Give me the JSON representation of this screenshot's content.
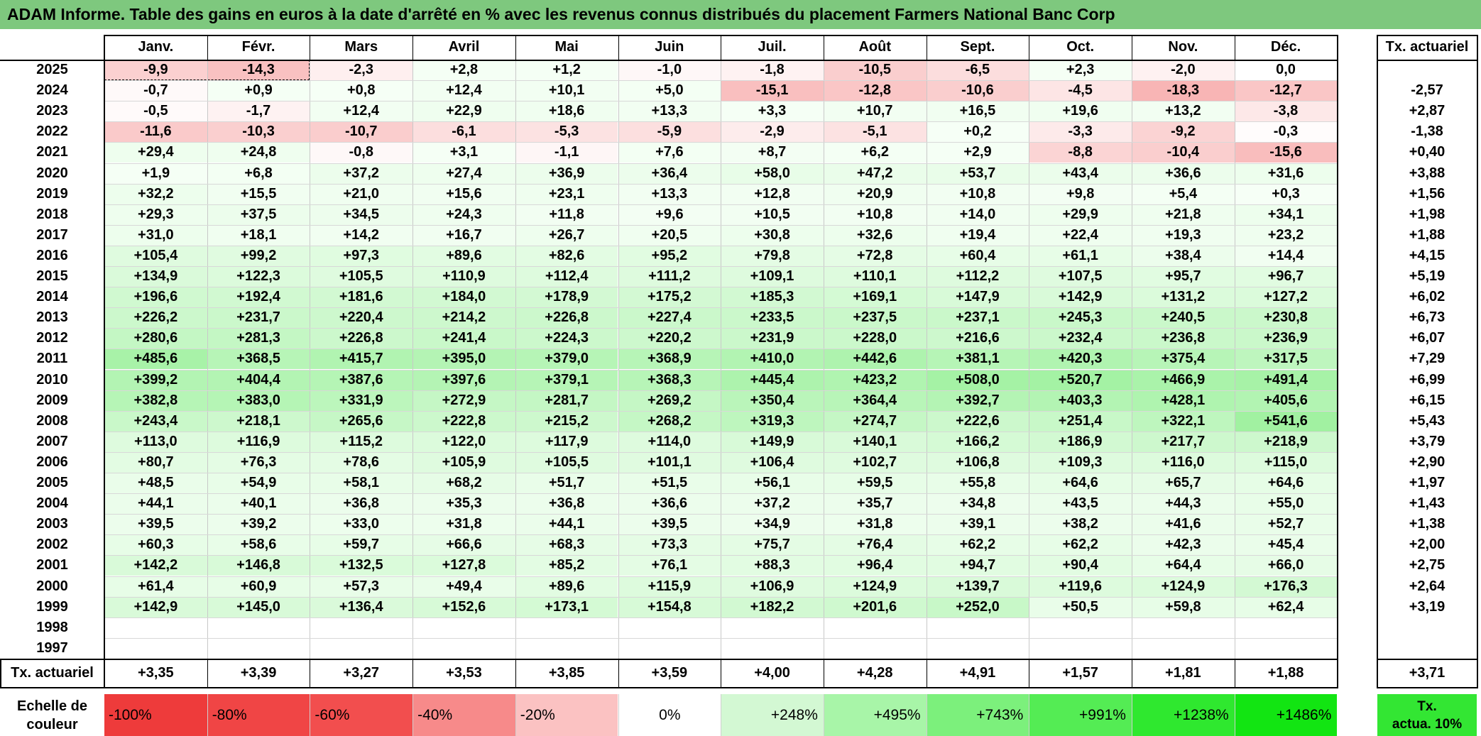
{
  "title": "ADAM Informe. Table des gains en euros à la date d'arrêté en % avec les revenus connus distribués du placement Farmers National Banc Corp",
  "chart_data": {
    "type": "table",
    "months": [
      "Janv.",
      "Févr.",
      "Mars",
      "Avril",
      "Mai",
      "Juin",
      "Juil.",
      "Août",
      "Sept.",
      "Oct.",
      "Nov.",
      "Déc."
    ],
    "actuarial_header": "Tx. actuariel",
    "rows": [
      {
        "year": "2025",
        "values": [
          "-9,9",
          "-14,3",
          "-2,3",
          "+2,8",
          "+1,2",
          "-1,0",
          "-1,8",
          "-10,5",
          "-6,5",
          "+2,3",
          "-2,0",
          "0,0"
        ],
        "rate": ""
      },
      {
        "year": "2024",
        "values": [
          "-0,7",
          "+0,9",
          "+0,8",
          "+12,4",
          "+10,1",
          "+5,0",
          "-15,1",
          "-12,8",
          "-10,6",
          "-4,5",
          "-18,3",
          "-12,7"
        ],
        "rate": "-2,57"
      },
      {
        "year": "2023",
        "values": [
          "-0,5",
          "-1,7",
          "+12,4",
          "+22,9",
          "+18,6",
          "+13,3",
          "+3,3",
          "+10,7",
          "+16,5",
          "+19,6",
          "+13,2",
          "-3,8"
        ],
        "rate": "+2,87"
      },
      {
        "year": "2022",
        "values": [
          "-11,6",
          "-10,3",
          "-10,7",
          "-6,1",
          "-5,3",
          "-5,9",
          "-2,9",
          "-5,1",
          "+0,2",
          "-3,3",
          "-9,2",
          "-0,3"
        ],
        "rate": "-1,38"
      },
      {
        "year": "2021",
        "values": [
          "+29,4",
          "+24,8",
          "-0,8",
          "+3,1",
          "-1,1",
          "+7,6",
          "+8,7",
          "+6,2",
          "+2,9",
          "-8,8",
          "-10,4",
          "-15,6"
        ],
        "rate": "+0,40"
      },
      {
        "year": "2020",
        "values": [
          "+1,9",
          "+6,8",
          "+37,2",
          "+27,4",
          "+36,9",
          "+36,4",
          "+58,0",
          "+47,2",
          "+53,7",
          "+43,4",
          "+36,6",
          "+31,6"
        ],
        "rate": "+3,88"
      },
      {
        "year": "2019",
        "values": [
          "+32,2",
          "+15,5",
          "+21,0",
          "+15,6",
          "+23,1",
          "+13,3",
          "+12,8",
          "+20,9",
          "+10,8",
          "+9,8",
          "+5,4",
          "+0,3"
        ],
        "rate": "+1,56"
      },
      {
        "year": "2018",
        "values": [
          "+29,3",
          "+37,5",
          "+34,5",
          "+24,3",
          "+11,8",
          "+9,6",
          "+10,5",
          "+10,8",
          "+14,0",
          "+29,9",
          "+21,8",
          "+34,1"
        ],
        "rate": "+1,98"
      },
      {
        "year": "2017",
        "values": [
          "+31,0",
          "+18,1",
          "+14,2",
          "+16,7",
          "+26,7",
          "+20,5",
          "+30,8",
          "+32,6",
          "+19,4",
          "+22,4",
          "+19,3",
          "+23,2"
        ],
        "rate": "+1,88"
      },
      {
        "year": "2016",
        "values": [
          "+105,4",
          "+99,2",
          "+97,3",
          "+89,6",
          "+82,6",
          "+95,2",
          "+79,8",
          "+72,8",
          "+60,4",
          "+61,1",
          "+38,4",
          "+14,4"
        ],
        "rate": "+4,15"
      },
      {
        "year": "2015",
        "values": [
          "+134,9",
          "+122,3",
          "+105,5",
          "+110,9",
          "+112,4",
          "+111,2",
          "+109,1",
          "+110,1",
          "+112,2",
          "+107,5",
          "+95,7",
          "+96,7"
        ],
        "rate": "+5,19"
      },
      {
        "year": "2014",
        "values": [
          "+196,6",
          "+192,4",
          "+181,6",
          "+184,0",
          "+178,9",
          "+175,2",
          "+185,3",
          "+169,1",
          "+147,9",
          "+142,9",
          "+131,2",
          "+127,2"
        ],
        "rate": "+6,02"
      },
      {
        "year": "2013",
        "values": [
          "+226,2",
          "+231,7",
          "+220,4",
          "+214,2",
          "+226,8",
          "+227,4",
          "+233,5",
          "+237,5",
          "+237,1",
          "+245,3",
          "+240,5",
          "+230,8"
        ],
        "rate": "+6,73"
      },
      {
        "year": "2012",
        "values": [
          "+280,6",
          "+281,3",
          "+226,8",
          "+241,4",
          "+224,3",
          "+220,2",
          "+231,9",
          "+228,0",
          "+216,6",
          "+232,4",
          "+236,8",
          "+236,9"
        ],
        "rate": "+6,07"
      },
      {
        "year": "2011",
        "values": [
          "+485,6",
          "+368,5",
          "+415,7",
          "+395,0",
          "+379,0",
          "+368,9",
          "+410,0",
          "+442,6",
          "+381,1",
          "+420,3",
          "+375,4",
          "+317,5"
        ],
        "rate": "+7,29"
      },
      {
        "year": "2010",
        "values": [
          "+399,2",
          "+404,4",
          "+387,6",
          "+397,6",
          "+379,1",
          "+368,3",
          "+445,4",
          "+423,2",
          "+508,0",
          "+520,7",
          "+466,9",
          "+491,4"
        ],
        "rate": "+6,99"
      },
      {
        "year": "2009",
        "values": [
          "+382,8",
          "+383,0",
          "+331,9",
          "+272,9",
          "+281,7",
          "+269,2",
          "+350,4",
          "+364,4",
          "+392,7",
          "+403,3",
          "+428,1",
          "+405,6"
        ],
        "rate": "+6,15"
      },
      {
        "year": "2008",
        "values": [
          "+243,4",
          "+218,1",
          "+265,6",
          "+222,8",
          "+215,2",
          "+268,2",
          "+319,3",
          "+274,7",
          "+222,6",
          "+251,4",
          "+322,1",
          "+541,6"
        ],
        "rate": "+5,43"
      },
      {
        "year": "2007",
        "values": [
          "+113,0",
          "+116,9",
          "+115,2",
          "+122,0",
          "+117,9",
          "+114,0",
          "+149,9",
          "+140,1",
          "+166,2",
          "+186,9",
          "+217,7",
          "+218,9"
        ],
        "rate": "+3,79"
      },
      {
        "year": "2006",
        "values": [
          "+80,7",
          "+76,3",
          "+78,6",
          "+105,9",
          "+105,5",
          "+101,1",
          "+106,4",
          "+102,7",
          "+106,8",
          "+109,3",
          "+116,0",
          "+115,0"
        ],
        "rate": "+2,90"
      },
      {
        "year": "2005",
        "values": [
          "+48,5",
          "+54,9",
          "+58,1",
          "+68,2",
          "+51,7",
          "+51,5",
          "+56,1",
          "+59,5",
          "+55,8",
          "+64,6",
          "+65,7",
          "+64,6"
        ],
        "rate": "+1,97"
      },
      {
        "year": "2004",
        "values": [
          "+44,1",
          "+40,1",
          "+36,8",
          "+35,3",
          "+36,8",
          "+36,6",
          "+37,2",
          "+35,7",
          "+34,8",
          "+43,5",
          "+44,3",
          "+55,0"
        ],
        "rate": "+1,43"
      },
      {
        "year": "2003",
        "values": [
          "+39,5",
          "+39,2",
          "+33,0",
          "+31,8",
          "+44,1",
          "+39,5",
          "+34,9",
          "+31,8",
          "+39,1",
          "+38,2",
          "+41,6",
          "+52,7"
        ],
        "rate": "+1,38"
      },
      {
        "year": "2002",
        "values": [
          "+60,3",
          "+58,6",
          "+59,7",
          "+66,6",
          "+68,3",
          "+73,3",
          "+75,7",
          "+76,4",
          "+62,2",
          "+62,2",
          "+42,3",
          "+45,4"
        ],
        "rate": "+2,00"
      },
      {
        "year": "2001",
        "values": [
          "+142,2",
          "+146,8",
          "+132,5",
          "+127,8",
          "+85,2",
          "+76,1",
          "+88,3",
          "+96,4",
          "+94,7",
          "+90,4",
          "+64,4",
          "+66,0"
        ],
        "rate": "+2,75"
      },
      {
        "year": "2000",
        "values": [
          "+61,4",
          "+60,9",
          "+57,3",
          "+49,4",
          "+89,6",
          "+115,9",
          "+106,9",
          "+124,9",
          "+139,7",
          "+119,6",
          "+124,9",
          "+176,3"
        ],
        "rate": "+2,64"
      },
      {
        "year": "1999",
        "values": [
          "+142,9",
          "+145,0",
          "+136,4",
          "+152,6",
          "+173,1",
          "+154,8",
          "+182,2",
          "+201,6",
          "+252,0",
          "+50,5",
          "+59,8",
          "+62,4"
        ],
        "rate": "+3,19"
      },
      {
        "year": "1998",
        "values": [
          "",
          "",
          "",
          "",
          "",
          "",
          "",
          "",
          "",
          "",
          "",
          ""
        ],
        "rate": ""
      },
      {
        "year": "1997",
        "values": [
          "",
          "",
          "",
          "",
          "",
          "",
          "",
          "",
          "",
          "",
          "",
          ""
        ],
        "rate": ""
      }
    ],
    "footer": {
      "label": "Tx. actuariel",
      "values": [
        "+3,35",
        "+3,39",
        "+3,27",
        "+3,53",
        "+3,85",
        "+3,59",
        "+4,00",
        "+4,28",
        "+4,91",
        "+1,57",
        "+1,81",
        "+1,88"
      ],
      "rate": "+3,71"
    },
    "color_scale": {
      "label_line1": "Echelle de",
      "label_line2": "couleur",
      "steps": [
        {
          "label": "-100%",
          "color": "#ee3b3b"
        },
        {
          "label": "-80%",
          "color": "#f04545"
        },
        {
          "label": "-60%",
          "color": "#f24e4e"
        },
        {
          "label": "-40%",
          "color": "#f78a8a"
        },
        {
          "label": "-20%",
          "color": "#fbc2c2"
        },
        {
          "label": "0%",
          "color": "#ffffff"
        },
        {
          "label": "+248%",
          "color": "#d3f8d3"
        },
        {
          "label": "+495%",
          "color": "#a8f5a8"
        },
        {
          "label": "+743%",
          "color": "#7cf07c"
        },
        {
          "label": "+991%",
          "color": "#54ec54"
        },
        {
          "label": "+1238%",
          "color": "#2fe82f"
        },
        {
          "label": "+1486%",
          "color": "#12e512"
        }
      ],
      "actuarial_line1": "Tx.",
      "actuarial_line2": "actua. 10%",
      "actuarial_color": "#33e633"
    }
  }
}
